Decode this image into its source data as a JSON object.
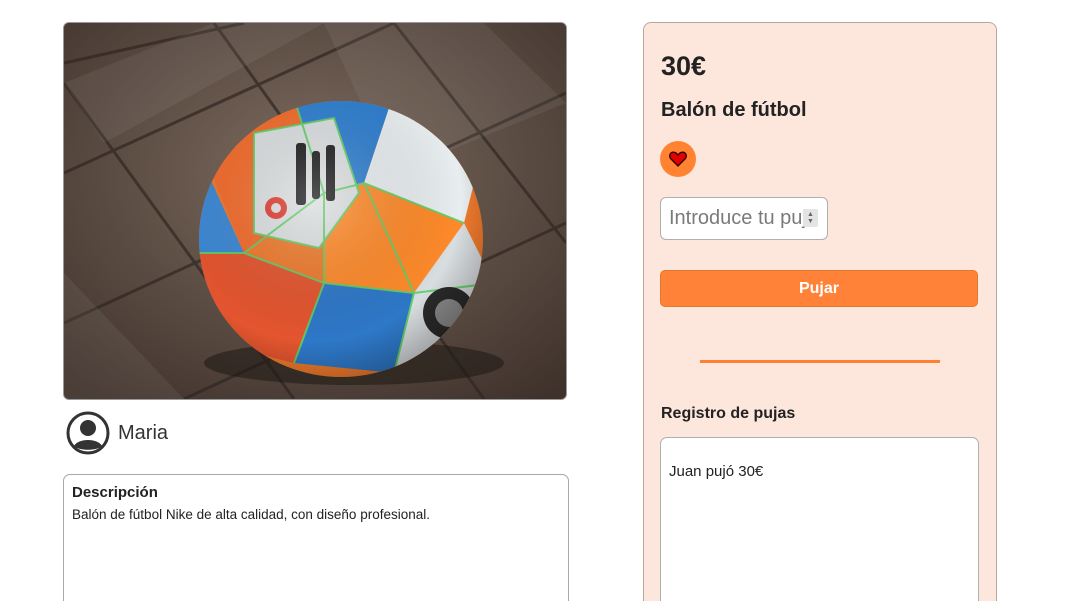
{
  "product": {
    "price": "30€",
    "title": "Balón de fútbol",
    "image_alt": "Balón de fútbol"
  },
  "seller": {
    "name": "Maria",
    "avatar_icon": "user-circle-icon"
  },
  "description": {
    "heading": "Descripción",
    "text": "Balón de fútbol Nike de alta calidad, con diseño profesional."
  },
  "favorite": {
    "icon": "heart-icon",
    "color": "#ff8331",
    "heart_color": "#e00000"
  },
  "bid": {
    "placeholder": "Introduce tu puja",
    "button_label": "Pujar",
    "accent_color": "#ff8238"
  },
  "bid_log": {
    "heading": "Registro de pujas",
    "entries": [
      "Juan pujó 30€"
    ]
  },
  "colors": {
    "panel_background": "#fde6dc",
    "accent": "#ff8030"
  }
}
